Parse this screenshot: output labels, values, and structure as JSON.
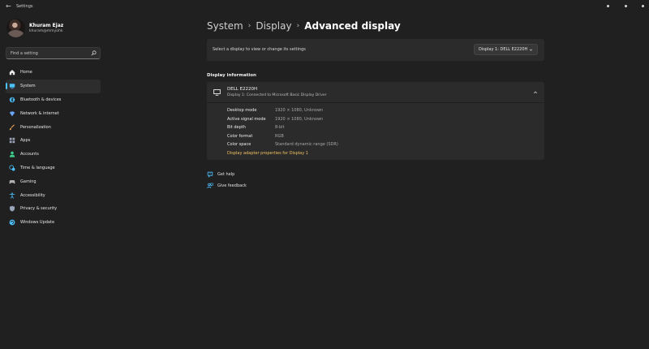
{
  "window": {
    "title": "Settings",
    "back_icon": "back-arrow-icon",
    "controls": [
      "minimize",
      "maximize",
      "close"
    ]
  },
  "profile": {
    "name": "Khuram Ejaz",
    "email": "khuram@mmyohk"
  },
  "search": {
    "placeholder": "Find a setting",
    "icon": "search-icon"
  },
  "sidebar": {
    "items": [
      {
        "label": "Home",
        "icon": "home-icon",
        "color": "#e8e8e8",
        "selected": false
      },
      {
        "label": "System",
        "icon": "system-icon",
        "color": "#4cc2ff",
        "selected": true
      },
      {
        "label": "Bluetooth & devices",
        "icon": "bluetooth-icon",
        "color": "#4cc2ff",
        "selected": false
      },
      {
        "label": "Network & internet",
        "icon": "network-icon",
        "color": "#6aa7ff",
        "selected": false
      },
      {
        "label": "Personalization",
        "icon": "brush-icon",
        "color": "#f2a65a",
        "selected": false
      },
      {
        "label": "Apps",
        "icon": "apps-icon",
        "color": "#9aa4b8",
        "selected": false
      },
      {
        "label": "Accounts",
        "icon": "accounts-icon",
        "color": "#3ccf8e",
        "selected": false
      },
      {
        "label": "Time & language",
        "icon": "globe-clock-icon",
        "color": "#4cc2ff",
        "selected": false
      },
      {
        "label": "Gaming",
        "icon": "gamepad-icon",
        "color": "#b0b0b0",
        "selected": false
      },
      {
        "label": "Accessibility",
        "icon": "accessibility-icon",
        "color": "#4cc2ff",
        "selected": false
      },
      {
        "label": "Privacy & security",
        "icon": "shield-icon",
        "color": "#9aa4b8",
        "selected": false
      },
      {
        "label": "Windows Update",
        "icon": "update-icon",
        "color": "#4cc2ff",
        "selected": false
      }
    ]
  },
  "breadcrumb": {
    "items": [
      "System",
      "Display"
    ],
    "separator": "›",
    "current": "Advanced display"
  },
  "display_select": {
    "prompt": "Select a display to view or change its settings",
    "selected": "Display 1: DELL E2220H"
  },
  "display_info": {
    "section_title": "Display information",
    "monitor_name": "DELL E2220H",
    "monitor_sub": "Display 1: Connected to Microsoft Basic Display Driver",
    "rows": [
      {
        "label": "Desktop mode",
        "value": "1920 × 1080, Unknown"
      },
      {
        "label": "Active signal mode",
        "value": "1920 × 1080, Unknown"
      },
      {
        "label": "Bit depth",
        "value": "8-bit"
      },
      {
        "label": "Color format",
        "value": "RGB"
      },
      {
        "label": "Color space",
        "value": "Standard dynamic range (SDR)"
      }
    ],
    "adapter_link": "Display adapter properties for Display 1"
  },
  "help": {
    "get_help": "Get help",
    "give_feedback": "Give feedback"
  },
  "colors": {
    "background": "#202020",
    "card": "#2b2b2b",
    "accent": "#4cc2ff",
    "link": "#f0c060"
  }
}
